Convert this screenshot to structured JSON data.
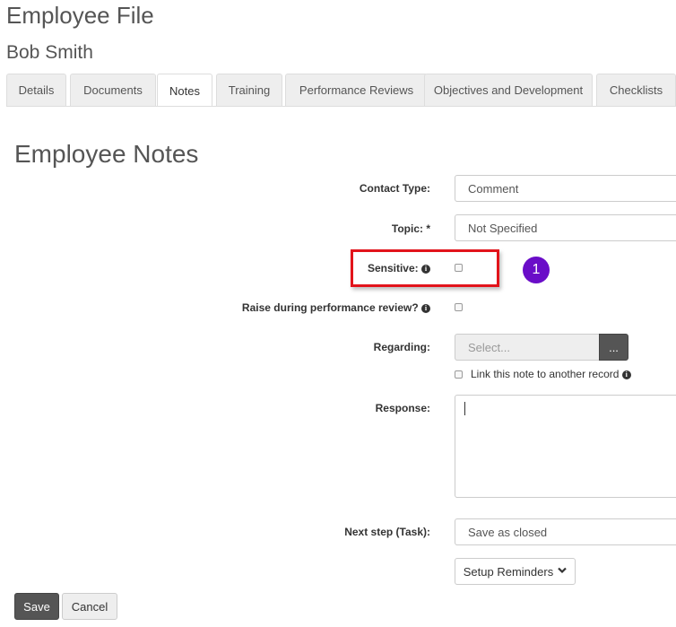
{
  "header": {
    "title": "Employee File",
    "employee_name": "Bob Smith"
  },
  "tabs": [
    {
      "label": "Details",
      "active": false
    },
    {
      "label": "Documents",
      "active": false
    },
    {
      "label": "Notes",
      "active": true
    },
    {
      "label": "Training",
      "active": false
    },
    {
      "label": "Performance Reviews",
      "active": false
    },
    {
      "label": "Objectives and Development",
      "active": false
    },
    {
      "label": "Checklists",
      "active": false
    }
  ],
  "section": {
    "title": "Employee Notes"
  },
  "form": {
    "contact_type": {
      "label": "Contact Type:",
      "value": "Comment"
    },
    "topic": {
      "label": "Topic: *",
      "value": "Not Specified"
    },
    "sensitive": {
      "label": "Sensitive:",
      "checked": false
    },
    "raise_review": {
      "label": "Raise during performance review?",
      "checked": false
    },
    "regarding": {
      "label": "Regarding:",
      "placeholder": "Select...",
      "browse_label": "..."
    },
    "link_note": {
      "label": "Link this note to another record",
      "checked": false
    },
    "response": {
      "label": "Response:",
      "value": ""
    },
    "next_step": {
      "label": "Next step (Task):",
      "value": "Save as closed"
    },
    "setup_reminders": {
      "label": "Setup Reminders"
    }
  },
  "annotation": {
    "step_number": "1",
    "highlight_color": "#e2141b",
    "badge_color": "#6a0dc8"
  },
  "actions": {
    "save_label": "Save",
    "cancel_label": "Cancel"
  },
  "icons": {
    "info": "info-circle-icon",
    "chevron": "chevron-down-icon"
  }
}
